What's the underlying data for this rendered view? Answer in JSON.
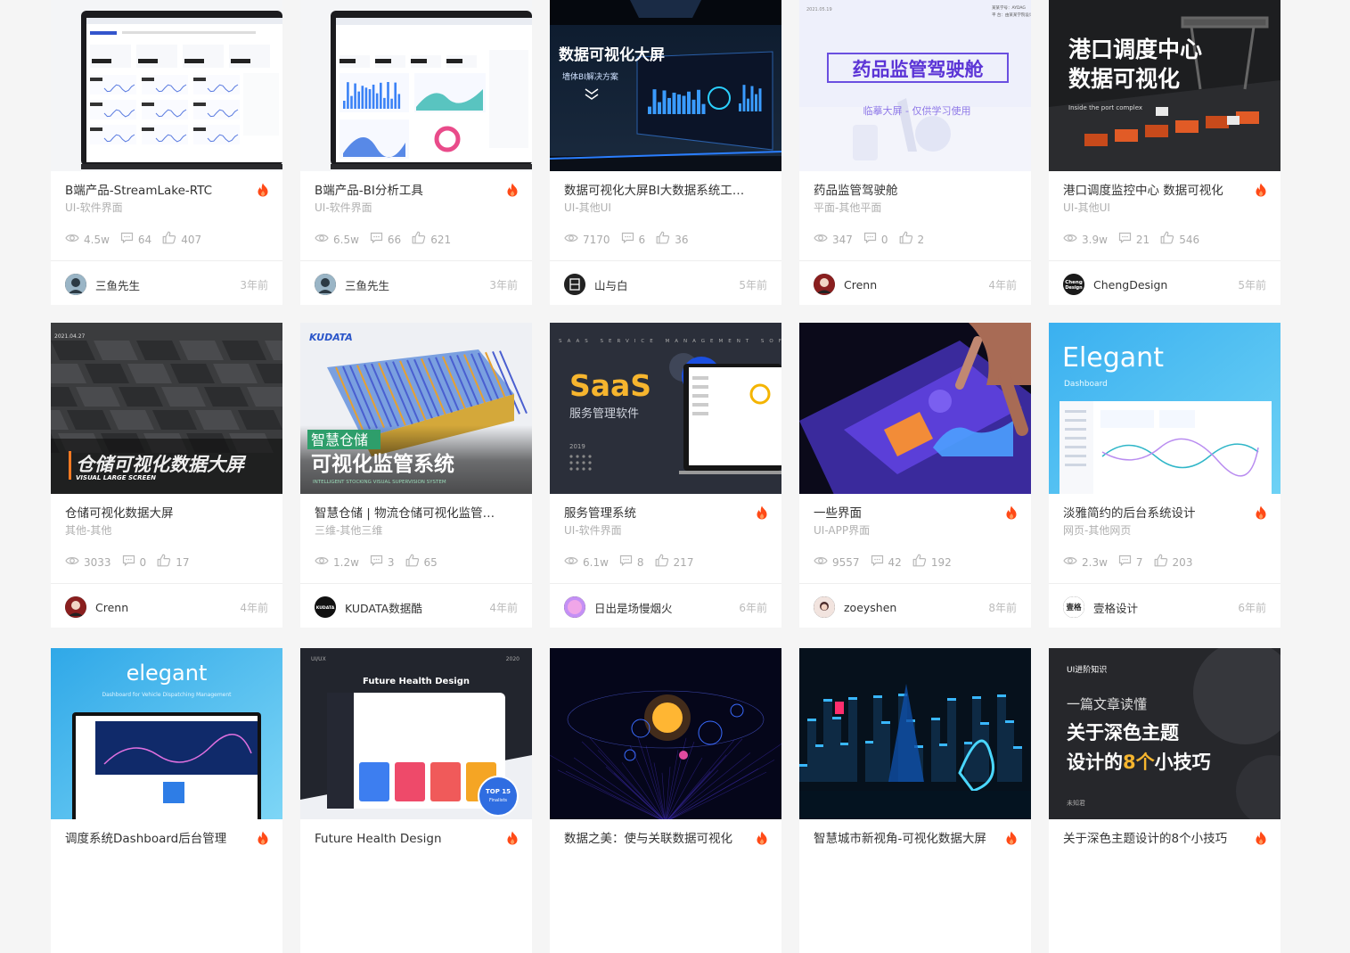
{
  "colors": {
    "hot": "#ff4a17",
    "muted": "#b0b0b0",
    "text": "#333333"
  },
  "cards": [
    {
      "title": "B端产品-StreamLake-RTC",
      "category": "UI-软件界面",
      "views": "4.5w",
      "comments": "64",
      "likes": "407",
      "author": "三鱼先生",
      "time": "3年前",
      "hot": true,
      "thumb": "laptop1",
      "avatar": "a-fish"
    },
    {
      "title": "B端产品-BI分析工具",
      "category": "UI-软件界面",
      "views": "6.5w",
      "comments": "66",
      "likes": "621",
      "author": "三鱼先生",
      "time": "3年前",
      "hot": true,
      "thumb": "laptop2",
      "avatar": "a-fish"
    },
    {
      "title": "数据可视化大屏BI大数据系统工厂...",
      "category": "UI-其他UI",
      "views": "7170",
      "comments": "6",
      "likes": "36",
      "author": "山与白",
      "time": "5年前",
      "hot": false,
      "thumb": "bigscreen",
      "avatar": "a-mountain",
      "thumb_text": {
        "title": "数据可视化大屏",
        "sub": "墙体BI解决方案"
      }
    },
    {
      "title": "药品监管驾驶舱",
      "category": "平面-其他平面",
      "views": "347",
      "comments": "0",
      "likes": "2",
      "author": "Crenn",
      "time": "4年前",
      "hot": false,
      "thumb": "pharma",
      "avatar": "a-crenn",
      "thumb_text": {
        "date": "2021.05.19",
        "title": "药品监管驾驶舱",
        "sub": "临摹大屏 - 仅供学习使用",
        "corner1": "某某学号：AYDAG",
        "corner2": "平 台：由某某学院设计"
      }
    },
    {
      "title": "港口调度监控中心 数据可视化",
      "category": "UI-其他UI",
      "views": "3.9w",
      "comments": "21",
      "likes": "546",
      "author": "ChengDesign",
      "time": "5年前",
      "hot": true,
      "thumb": "port",
      "avatar": "a-cheng",
      "avatar_text": "Cheng Design",
      "thumb_text": {
        "line1": "港口调度中心",
        "line2": "数据可视化",
        "sub": "Inside the port complex"
      }
    },
    {
      "title": "仓储可视化数据大屏",
      "category": "其他-其他",
      "views": "3033",
      "comments": "0",
      "likes": "17",
      "author": "Crenn",
      "time": "4年前",
      "hot": false,
      "thumb": "warehouse",
      "avatar": "a-crenn",
      "thumb_text": {
        "date": "2021.04.27",
        "title": "仓储可视化数据大屏",
        "sub": "VISUAL LARGE SCREEN"
      }
    },
    {
      "title": "智慧仓储 | 物流仓储可视化监管系统",
      "category": "三维-其他三维",
      "views": "1.2w",
      "comments": "3",
      "likes": "65",
      "author": "KUDATA数据酷",
      "time": "4年前",
      "hot": false,
      "thumb": "kudata",
      "avatar": "a-kudata",
      "avatar_text": "KUDATA",
      "thumb_text": {
        "logo": "KUDATA",
        "tag": "智慧仓储",
        "title": "可视化监管系统",
        "sub": "INTELLIGENT STOCKING VISUAL SUPERVISION SYSTEM"
      }
    },
    {
      "title": "服务管理系统",
      "category": "UI-软件界面",
      "views": "6.1w",
      "comments": "8",
      "likes": "217",
      "author": "日出是场慢烟火",
      "time": "6年前",
      "hot": true,
      "thumb": "saas",
      "avatar": "a-sun",
      "thumb_text": {
        "top": "SAAS SERVICE MANAGEMENT SOFT",
        "title": "SaaS",
        "sub": "服务管理软件",
        "year": "2019"
      }
    },
    {
      "title": "一些界面",
      "category": "UI-APP界面",
      "views": "9557",
      "comments": "42",
      "likes": "192",
      "author": "zoeyshen",
      "time": "8年前",
      "hot": true,
      "thumb": "tablet",
      "avatar": "a-zoey"
    },
    {
      "title": "淡雅简约的后台系统设计",
      "category": "网页-其他网页",
      "views": "2.3w",
      "comments": "7",
      "likes": "203",
      "author": "壹格设计",
      "time": "6年前",
      "hot": true,
      "thumb": "elegant",
      "avatar": "a-yige",
      "avatar_text": "壹格",
      "thumb_text": {
        "title": "Elegant",
        "sub": "Dashboard"
      }
    },
    {
      "title": "调度系统Dashboard后台管理",
      "category": "",
      "views": "",
      "comments": "",
      "likes": "",
      "author": "",
      "time": "",
      "hot": true,
      "thumb": "elegant2",
      "avatar": "",
      "thumb_text": {
        "title": "elegant",
        "sub": "Dashboard for Vehicle Dispatching Management"
      }
    },
    {
      "title": "Future Health Design",
      "category": "",
      "views": "",
      "comments": "",
      "likes": "",
      "author": "",
      "time": "",
      "hot": true,
      "thumb": "health",
      "avatar": "",
      "thumb_text": {
        "left": "UI/UX",
        "right": "2020",
        "title": "Future Health Design",
        "badge": "TOP 15",
        "badge2": "Finalists"
      }
    },
    {
      "title": "数据之美：使与关联数据可视化",
      "category": "",
      "views": "",
      "comments": "",
      "likes": "",
      "author": "",
      "time": "",
      "hot": true,
      "thumb": "planets",
      "avatar": ""
    },
    {
      "title": "智慧城市新视角-可视化数据大屏",
      "category": "",
      "views": "",
      "comments": "",
      "likes": "",
      "author": "",
      "time": "",
      "hot": true,
      "thumb": "city",
      "avatar": ""
    },
    {
      "title": "关于深色主题设计的8个小技巧",
      "category": "",
      "views": "",
      "comments": "",
      "likes": "",
      "author": "",
      "time": "",
      "hot": true,
      "thumb": "darktheme",
      "avatar": "",
      "thumb_text": {
        "tag": "UI进阶知识",
        "line1": "一篇文章读懂",
        "line2": "关于深色主题",
        "line3a": "设计的",
        "line3b": "8个",
        "line3c": "小技巧",
        "foot": "未知君"
      }
    }
  ]
}
